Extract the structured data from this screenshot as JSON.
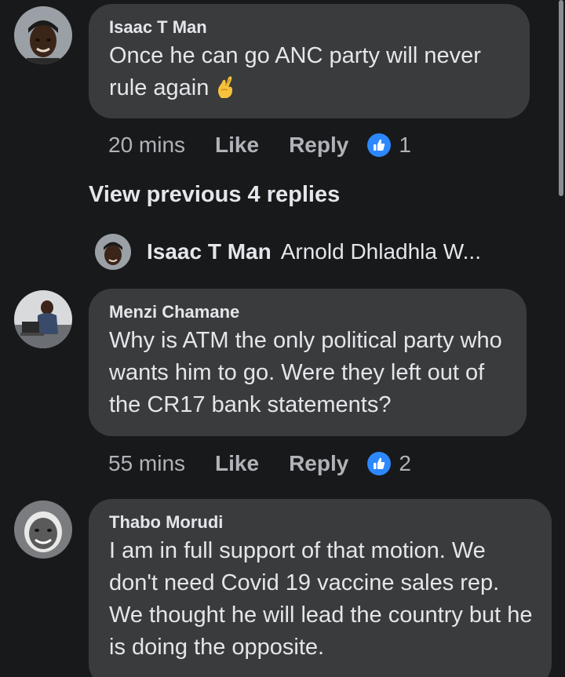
{
  "comments": [
    {
      "author": "Isaac T Man",
      "text": "Once he can go ANC party will never rule again",
      "time": "20 mins",
      "like_label": "Like",
      "reply_label": "Reply",
      "reaction_count": "1",
      "emoji_icon": "crossed-fingers-icon"
    },
    {
      "author": "Menzi Chamane",
      "text": "Why is ATM the only political party who wants him to go. Were they left out of the CR17 bank statements?",
      "time": "55 mins",
      "like_label": "Like",
      "reply_label": "Reply",
      "reaction_count": "2"
    },
    {
      "author": "Thabo Morudi",
      "text": "I am in full support of that motion. We don't need Covid 19 vaccine sales rep. We thought he will lead the country but he is doing the opposite."
    }
  ],
  "view_previous": "View previous 4 replies",
  "collapsed_reply": {
    "author": "Isaac T Man",
    "snippet": "Arnold Dhladhla W..."
  },
  "colors": {
    "background": "#18191a",
    "bubble": "#3a3b3c",
    "text": "#e4e6eb",
    "secondary_text": "#b0b3b8",
    "like_blue": "#2d88ff",
    "emoji_yellow": "#f7c23b"
  }
}
